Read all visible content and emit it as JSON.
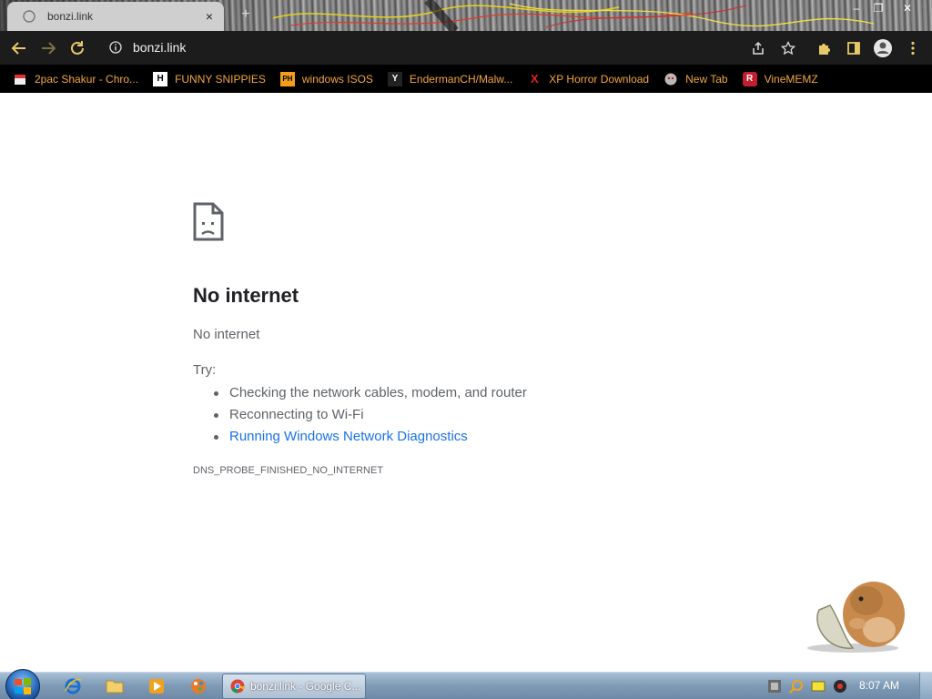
{
  "tab": {
    "title": "bonzi.link",
    "close_glyph": "×",
    "new_tab_glyph": "+"
  },
  "window_controls": {
    "minimize": "–",
    "restore": "❐",
    "close": "✕"
  },
  "toolbar": {
    "url": "bonzi.link",
    "info_icon": "info-icon"
  },
  "bookmarks": [
    {
      "label": "2pac Shakur - Chro...",
      "icon": "bookmark-icon-2pac"
    },
    {
      "label": "FUNNY SNIPPIES",
      "icon": "H"
    },
    {
      "label": "windows ISOS",
      "icon": "PH"
    },
    {
      "label": "EndermanCH/Malw...",
      "icon": "Y"
    },
    {
      "label": "XP Horror Download",
      "icon": "X"
    },
    {
      "label": "New Tab",
      "icon": "new-tab-favicon"
    },
    {
      "label": "VineMEMZ",
      "icon": "R"
    }
  ],
  "error": {
    "title": "No internet",
    "subtitle": "No internet",
    "try_label": "Try:",
    "suggestions": [
      "Checking the network cables, modem, and router",
      "Reconnecting to Wi-Fi",
      "Running Windows Network Diagnostics"
    ],
    "code": "DNS_PROBE_FINISHED_NO_INTERNET"
  },
  "taskbar": {
    "task_label": "bonzi.link - Google C...",
    "clock": "8:07 AM"
  },
  "colors": {
    "bookmark_text": "#f2a73b",
    "link": "#1a73e8",
    "error_text": "#5f6368",
    "toolbar_bg": "#1c1c1c"
  }
}
